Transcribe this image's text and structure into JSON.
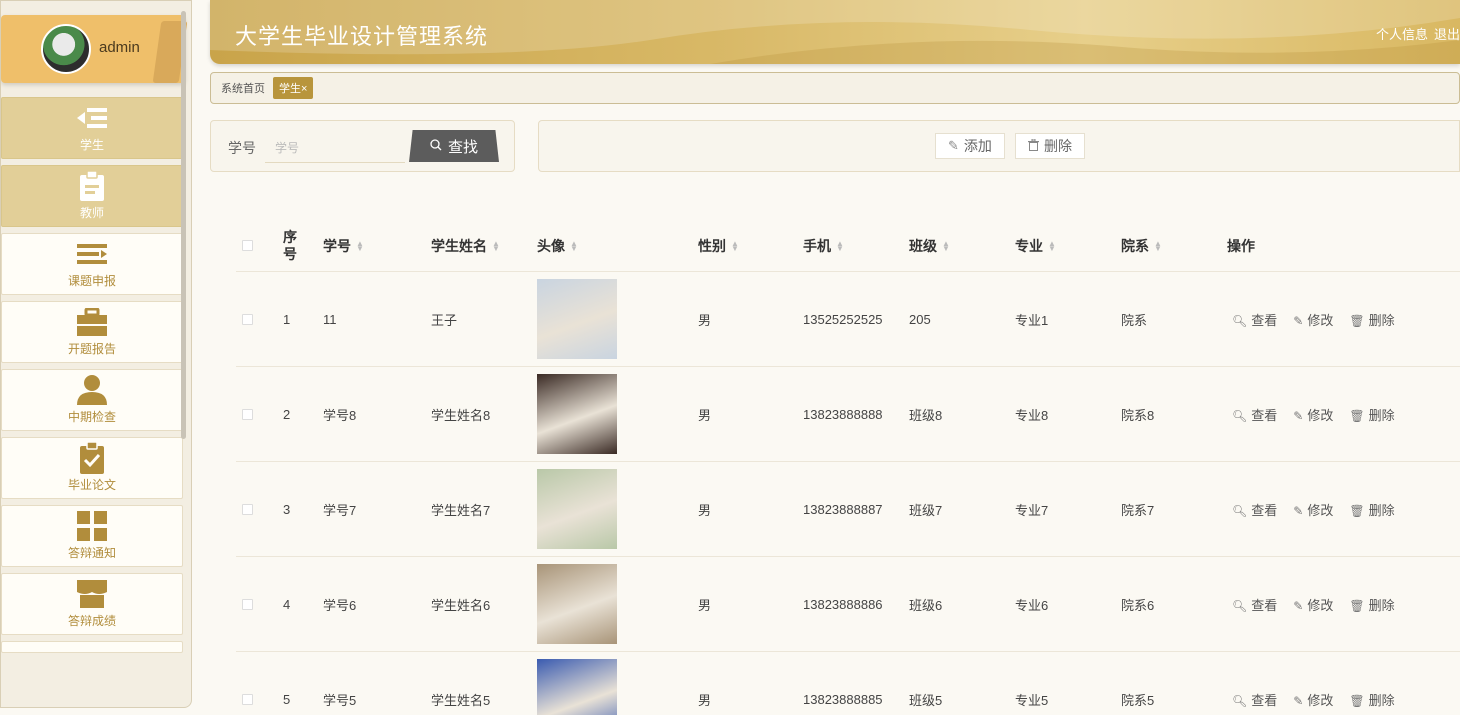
{
  "user": {
    "name": "admin"
  },
  "sidebar": {
    "items": [
      {
        "label": "学生",
        "icon": "list-indent-icon",
        "active": true
      },
      {
        "label": "教师",
        "icon": "clipboard-icon",
        "active": true
      },
      {
        "label": "课题申报",
        "icon": "list-icon",
        "active": false
      },
      {
        "label": "开题报告",
        "icon": "briefcase-icon",
        "active": false
      },
      {
        "label": "中期检查",
        "icon": "user-icon",
        "active": false
      },
      {
        "label": "毕业论文",
        "icon": "clipboard-check-icon",
        "active": false
      },
      {
        "label": "答辩通知",
        "icon": "grid-icon",
        "active": false
      },
      {
        "label": "答辩成绩",
        "icon": "shop-icon",
        "active": false
      }
    ]
  },
  "header": {
    "title": "大学生毕业设计管理系统",
    "profile_link": "个人信息",
    "logout_link": "退出"
  },
  "tabs": [
    {
      "label": "系统首页",
      "active": false
    },
    {
      "label": "学生",
      "close": "×",
      "active": true
    }
  ],
  "search": {
    "label": "学号",
    "placeholder": "学号",
    "button_label": "查找"
  },
  "actions": {
    "add_label": "添加",
    "delete_label": "删除"
  },
  "table": {
    "columns": [
      "序号",
      "学号",
      "学生姓名",
      "头像",
      "性别",
      "手机",
      "班级",
      "专业",
      "院系",
      "操作"
    ],
    "row_actions": {
      "view": "查看",
      "edit": "修改",
      "delete": "删除"
    },
    "rows": [
      {
        "index": "1",
        "student_no": "11",
        "name": "王子",
        "gender": "男",
        "phone": "13525252525",
        "class": "205",
        "major": "专业1",
        "dept": "院系",
        "photo_color": "#c9d4e0"
      },
      {
        "index": "2",
        "student_no": "学号8",
        "name": "学生姓名8",
        "gender": "男",
        "phone": "13823888888",
        "class": "班级8",
        "major": "专业8",
        "dept": "院系8",
        "photo_color": "#3a2a24"
      },
      {
        "index": "3",
        "student_no": "学号7",
        "name": "学生姓名7",
        "gender": "男",
        "phone": "13823888887",
        "class": "班级7",
        "major": "专业7",
        "dept": "院系7",
        "photo_color": "#b9c8a8"
      },
      {
        "index": "4",
        "student_no": "学号6",
        "name": "学生姓名6",
        "gender": "男",
        "phone": "13823888886",
        "class": "班级6",
        "major": "专业6",
        "dept": "院系6",
        "photo_color": "#a89478"
      },
      {
        "index": "5",
        "student_no": "学号5",
        "name": "学生姓名5",
        "gender": "男",
        "phone": "13823888885",
        "class": "班级5",
        "major": "专业5",
        "dept": "院系5",
        "photo_color": "#3a5bb0"
      }
    ]
  },
  "colors": {
    "accent": "#b8953c",
    "header_gold": "#d8b866",
    "menu_active": "#e2cf98",
    "search_button": "#5c5c5c"
  }
}
